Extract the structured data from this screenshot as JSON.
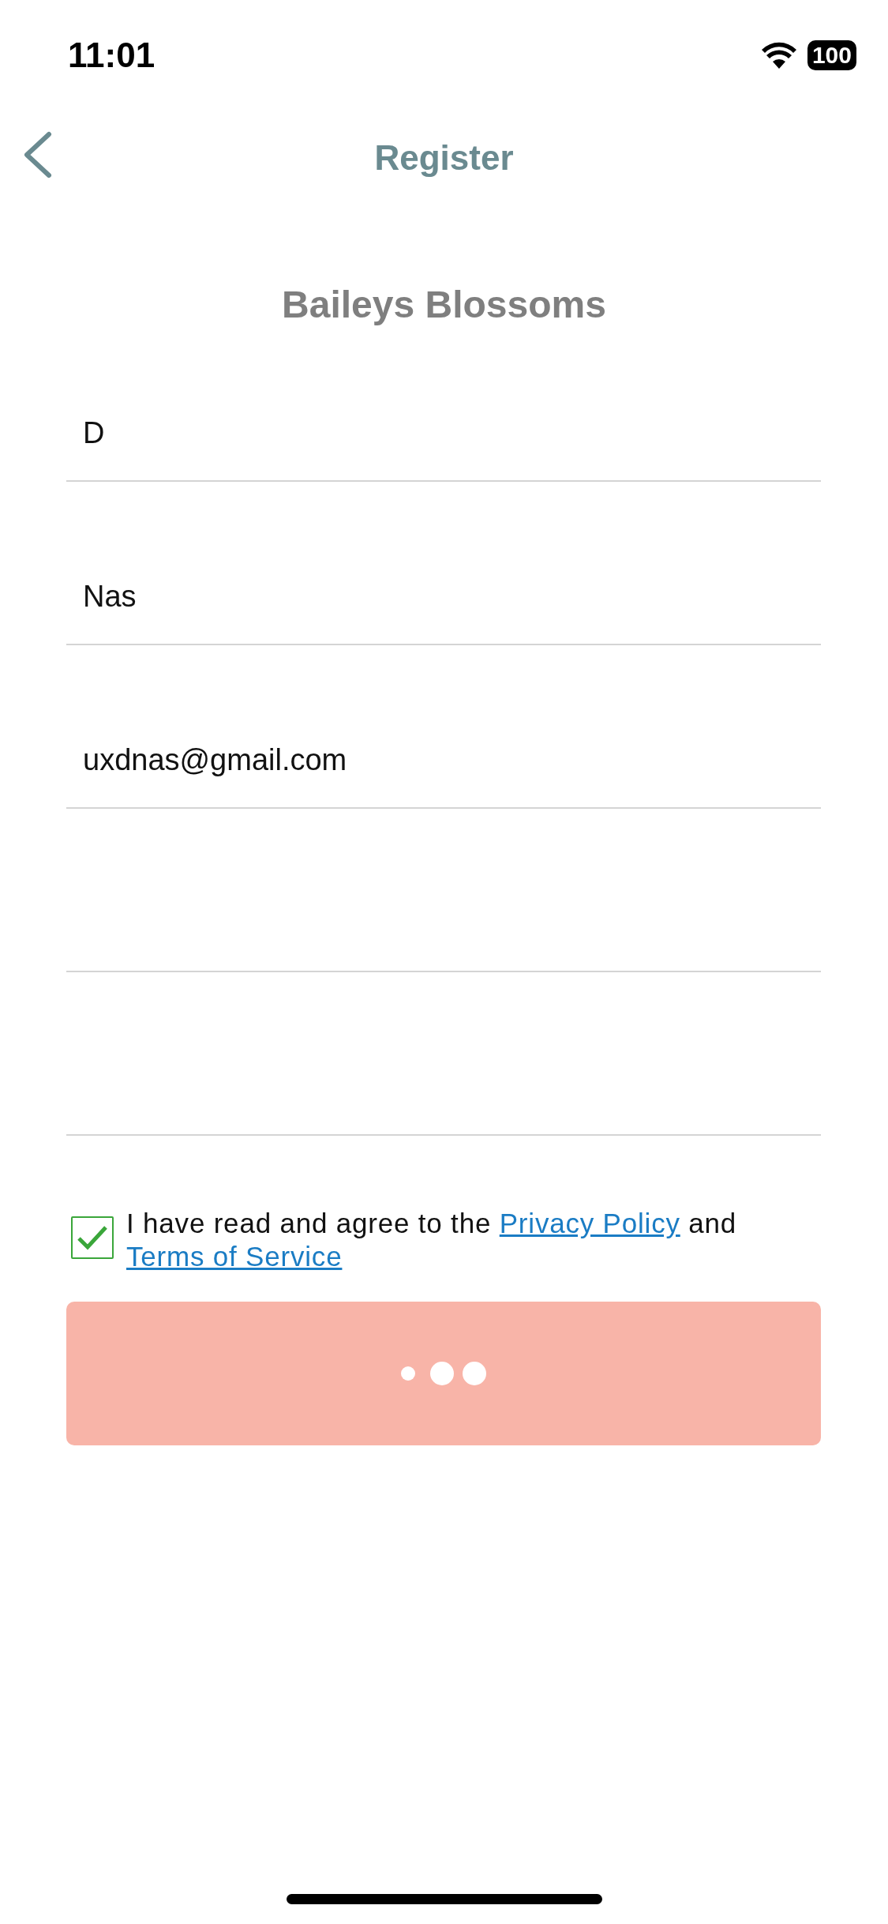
{
  "status_bar": {
    "time": "11:01",
    "battery": "100"
  },
  "header": {
    "title": "Register"
  },
  "brand": "Baileys Blossoms",
  "fields": [
    {
      "kind": "text",
      "value": "D"
    },
    {
      "kind": "text",
      "value": "Nas"
    },
    {
      "kind": "text",
      "value": "uxdnas@gmail.com"
    },
    {
      "kind": "text"
    },
    {
      "kind": "text"
    }
  ],
  "agreement": {
    "checked": true,
    "text_before": "I have read and agree to the",
    "link_1": "Privacy Policy",
    "text_middle": "and",
    "link_2": "Terms of Service"
  },
  "submit_button": {
    "loading": true
  }
}
